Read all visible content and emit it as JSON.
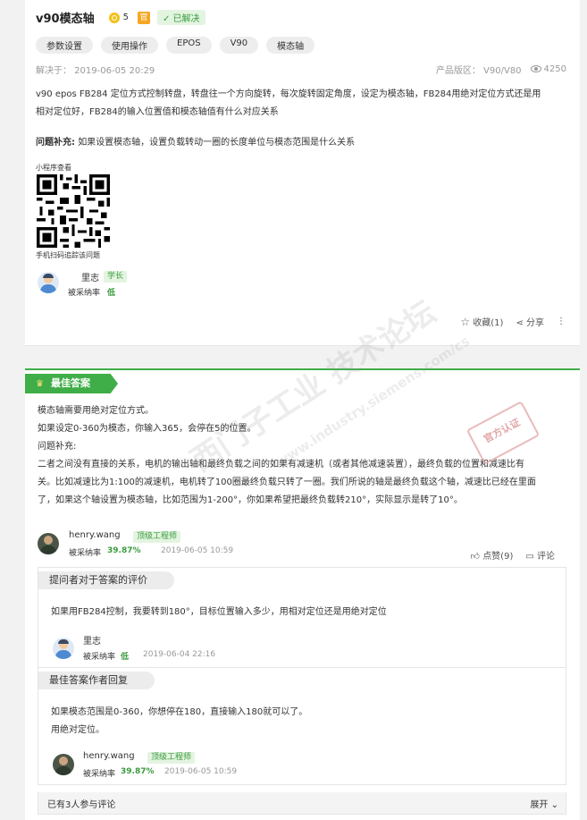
{
  "question": {
    "title": "v90模态轴",
    "coins": "5",
    "official_badge": "官",
    "solved_label": "✓ 已解决",
    "tags": [
      "参数设置",
      "使用操作",
      "EPOS",
      "V90",
      "模态轴"
    ],
    "solved_at": "解决于： 2019-06-05 20:29",
    "product": "产品版区： V90/V80",
    "views": "4250",
    "description_lines": [
      "v90 epos FB284 定位方式控制转盘，转盘往一个方向旋转，每次旋转固定角度，设定为模态轴，FB284用绝对定位方式还是用",
      "相对定位好，FB284的输入位置值和模态轴值有什么对应关系"
    ],
    "supplement_label": "问题补充:",
    "supplement_text": "如果设置模态轴，设置负载转动一圈的长度单位与模态范围是什么关系",
    "miniprogram_label": "小程序查看",
    "miniprogram_hint": "手机扫码追踪该问题",
    "author": {
      "name": "里志",
      "level": "学长",
      "rate_label": "被采纳率",
      "rate": "低"
    },
    "actions": {
      "favorite": "收藏(1)",
      "share": "分享",
      "more": "⋮"
    }
  },
  "best_answer": {
    "tab_label": "最佳答案",
    "lines": [
      "模态轴需要用绝对定位方式。",
      "如果设定0-360为模态，你输入365，会停在5的位置。",
      "问题补充:",
      "二者之间没有直接的关系，电机的输出轴和最终负载之间的如果有减速机（或者其他减速装置），最终负载的位置和减速比有",
      "关。比如减速比为1:100的减速机，电机转了100圈最终负载只转了一圈。我们所说的轴是最终负载这个轴，减速比已经在里面",
      "了，如果这个轴设置为模态轴，比如范围为1-200°，你如果希望把最终负载转210°，实际显示是转了10°。"
    ],
    "author": {
      "name": "henry.wang",
      "level": "顶级工程师",
      "rate_label": "被采纳率",
      "rate": "39.87%",
      "time": "2019-06-05 10:59"
    },
    "actions": {
      "like": "点赞(9)",
      "comment": "评论"
    },
    "stamp": "官方认证"
  },
  "asker_review": {
    "header": "提问者对于答案的评价",
    "text": "如果用FB284控制，我要转到180°，目标位置输入多少，用相对定位还是用绝对定位",
    "author": {
      "name": "里志",
      "rate_label": "被采纳率",
      "rate": "低",
      "time": "2019-06-04 22:16"
    }
  },
  "author_reply": {
    "header": "最佳答案作者回复",
    "lines": [
      "如果模态范围是0-360，你想停在180，直接输入180就可以了。",
      "用绝对定位。"
    ],
    "author": {
      "name": "henry.wang",
      "level": "顶级工程师",
      "rate_label": "被采纳率",
      "rate": "39.87%",
      "time": "2019-06-05 10:59"
    }
  },
  "footer": {
    "participants": "已有3人参与评论",
    "expand": "展开"
  },
  "watermark": {
    "cn": "西门子工业  技术论坛",
    "url": "www.industry.siemens.com/cs"
  },
  "colors": {
    "accent_green": "#3fae49",
    "coin": "#f4c11a",
    "official": "#f6a623"
  }
}
